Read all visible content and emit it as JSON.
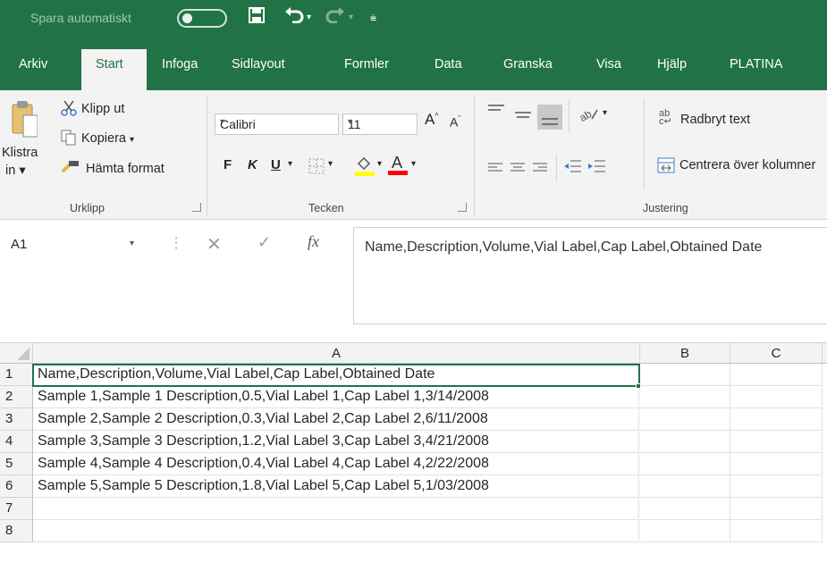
{
  "titlebar": {
    "autosave_label": "Spara automatiskt",
    "icons": [
      "save-icon",
      "undo-icon",
      "redo-icon",
      "customize-qat-icon"
    ]
  },
  "tabs": [
    "Arkiv",
    "Start",
    "Infoga",
    "Sidlayout",
    "Formler",
    "Data",
    "Granska",
    "Visa",
    "Hjälp",
    "PLATINA"
  ],
  "active_tab": "Start",
  "ribbon": {
    "clipboard": {
      "paste_label_1": "Klistra",
      "paste_label_2": "in",
      "cut": "Klipp ut",
      "copy": "Kopiera",
      "format_painter": "Hämta format",
      "group": "Urklipp"
    },
    "font": {
      "font_name": "Calibri",
      "font_size": "11",
      "bold": "F",
      "italic": "K",
      "underline": "U",
      "group": "Tecken"
    },
    "alignment": {
      "wrap_text": "Radbryt text",
      "wrap_icon_text": "ab",
      "merge_center": "Centrera över kolumner",
      "group": "Justering"
    }
  },
  "formula_bar": {
    "name_box": "A1",
    "fx": "fx",
    "content": "Name,Description,Volume,Vial Label,Cap Label,Obtained Date"
  },
  "grid": {
    "columns": [
      "A",
      "B",
      "C"
    ],
    "row_numbers": [
      "1",
      "2",
      "3",
      "4",
      "5",
      "6",
      "7",
      "8"
    ],
    "cells": [
      "Name,Description,Volume,Vial Label,Cap Label,Obtained Date",
      "Sample 1,Sample 1 Description,0.5,Vial Label 1,Cap Label 1,3/14/2008",
      "Sample 2,Sample 2 Description,0.3,Vial Label 2,Cap Label 2,6/11/2008",
      "Sample 3,Sample 3 Description,1.2,Vial Label 3,Cap Label 3,4/21/2008",
      "Sample 4,Sample 4 Description,0.4,Vial Label 4,Cap Label 4,2/22/2008",
      "Sample 5,Sample 5 Description,1.8,Vial Label 5,Cap Label 5,1/03/2008",
      "",
      ""
    ]
  },
  "colors": {
    "brand": "#217346",
    "highlight_fill": "#ffff00",
    "font_color": "#ff0000"
  }
}
